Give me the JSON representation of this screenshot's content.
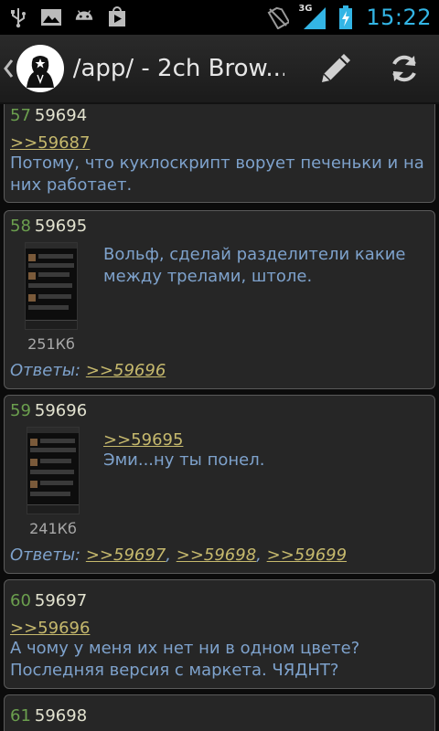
{
  "status_bar": {
    "time": "15:22",
    "network": "3G",
    "icons": [
      "usb-icon",
      "image-icon",
      "android-icon",
      "play-store-icon",
      "no-sim-icon",
      "signal-icon",
      "battery-charging-icon"
    ]
  },
  "action_bar": {
    "title": "/app/ - 2ch Brow...",
    "icons": [
      "up-chevron-icon",
      "anonymous-logo-icon",
      "pen-icon",
      "refresh-icon"
    ]
  },
  "colors": {
    "post_number": "#6b9f4e",
    "post_text": "#7ea2cc",
    "link": "#c6b96d",
    "card_bg": "#262626",
    "clock": "#33b5e5"
  },
  "posts": [
    {
      "num": "57",
      "id": "59694",
      "reply_link": ">>59687",
      "text_lines": [
        "Потому, что куклоскрипт ворует печеньки и на",
        "них работает."
      ]
    },
    {
      "num": "58",
      "id": "59695",
      "text_lines": [
        "Вольф, сделай разделители какие",
        "между трелами, штоле."
      ],
      "thumb_size": "251Кб",
      "answers_label": "Ответы:",
      "answers": [
        ">>59696"
      ]
    },
    {
      "num": "59",
      "id": "59696",
      "reply_link": ">>59695",
      "text_lines": [
        "Эми...ну ты понел."
      ],
      "thumb_size": "241Кб",
      "answers_label": "Ответы:",
      "answers": [
        ">>59697",
        ">>59698",
        ">>59699"
      ]
    },
    {
      "num": "60",
      "id": "59697",
      "reply_link": ">>59696",
      "text_lines": [
        "А чому у меня их нет ни в одном цвете?",
        "Последняя версия с маркета. ЧЯДНТ?"
      ]
    },
    {
      "num": "61",
      "id": "59698"
    }
  ]
}
